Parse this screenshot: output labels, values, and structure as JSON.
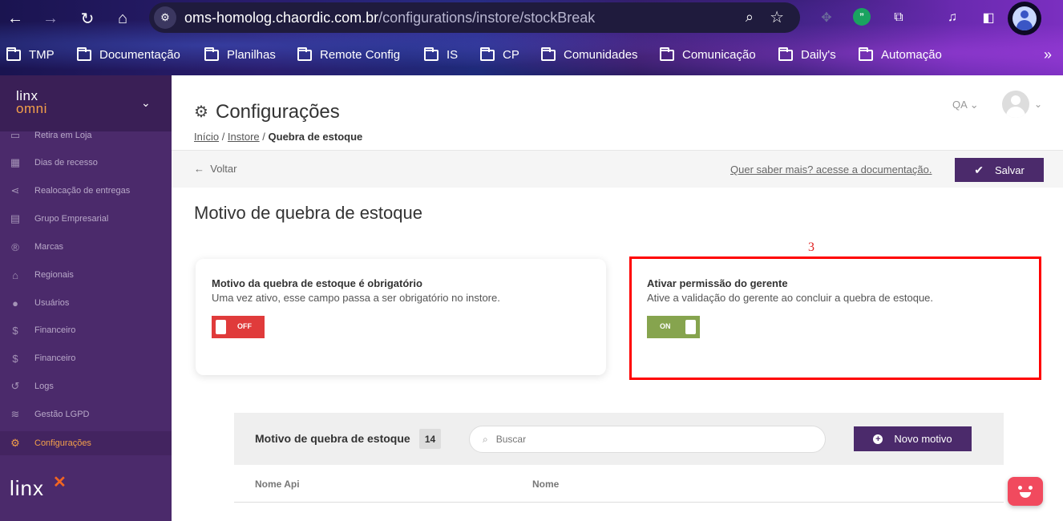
{
  "browser": {
    "url_host": "oms-homolog.chaordic.com.br",
    "url_path": "/configurations/instore/stockBreak",
    "bookmarks": [
      "TMP",
      "Documentação",
      "Planilhas",
      "Remote Config",
      "IS",
      "CP",
      "Comunidades",
      "Comunicação",
      "Daily's",
      "Automação"
    ]
  },
  "sidebar": {
    "brand_top": "linx",
    "brand_sub": "omni",
    "items": [
      {
        "label": "Retira em Loja",
        "icon": "store-icon"
      },
      {
        "label": "Dias de recesso",
        "icon": "calendar-icon"
      },
      {
        "label": "Realocação de entregas",
        "icon": "share-icon"
      },
      {
        "label": "Grupo Empresarial",
        "icon": "building-icon"
      },
      {
        "label": "Marcas",
        "icon": "registered-icon"
      },
      {
        "label": "Regionais",
        "icon": "bank-icon"
      },
      {
        "label": "Usuários",
        "icon": "users-icon"
      },
      {
        "label": "Financeiro",
        "icon": "dollar-icon"
      },
      {
        "label": "Financeiro",
        "icon": "dollar-icon"
      },
      {
        "label": "Logs",
        "icon": "history-icon"
      },
      {
        "label": "Gestão LGPD",
        "icon": "database-icon"
      },
      {
        "label": "Configurações",
        "icon": "gear-icon",
        "active": true
      }
    ],
    "brand_bottom": "linx"
  },
  "header": {
    "title": "Configurações",
    "breadcrumb": {
      "home": "Início",
      "section": "Instore",
      "current": "Quebra de estoque"
    },
    "env": "QA"
  },
  "toolbar": {
    "back_label": "Voltar",
    "doc_link": "Quer saber mais? acesse a documentação.",
    "save_label": "Salvar"
  },
  "section_title": "Motivo de quebra de estoque",
  "cards": [
    {
      "title": "Motivo da quebra de estoque é obrigatório",
      "description": "Uma vez ativo, esse campo passa a ser obrigatório no instore.",
      "toggle": "OFF"
    },
    {
      "title": "Ativar permissão do gerente",
      "description": "Ative a validação do gerente ao concluir a quebra de estoque.",
      "toggle": "ON"
    }
  ],
  "annotation": {
    "number": "3",
    "color": "#ff0000"
  },
  "table": {
    "title": "Motivo de quebra de estoque",
    "count": "14",
    "search_placeholder": "Buscar",
    "new_button": "Novo motivo",
    "columns": [
      "Nome Api",
      "Nome"
    ]
  },
  "colors": {
    "brand": "#4b2a6b",
    "accent": "#f4a04a",
    "toggle_off": "#e03b3b",
    "toggle_on": "#86a44e"
  }
}
